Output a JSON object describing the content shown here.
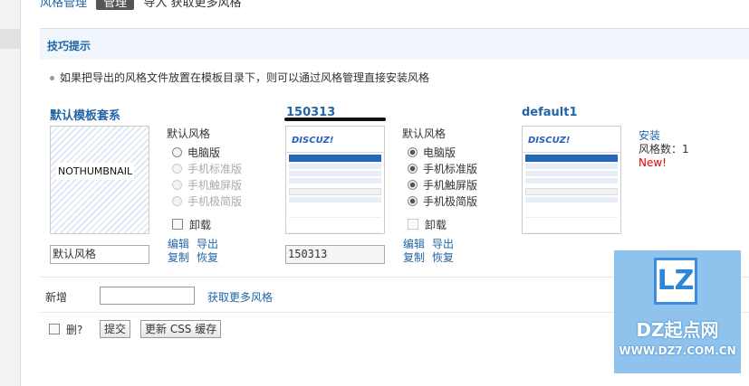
{
  "header": {
    "title": "风格管理",
    "tab_active": "管理",
    "tab_import": "导入",
    "tab_more": "获取更多风格"
  },
  "tips": {
    "heading": "技巧提示",
    "text": "如果把导出的风格文件放置在模板目录下，则可以通过风格管理直接安装风格"
  },
  "styles": [
    {
      "name": "默认模板套系",
      "thumb_text": "NOTHUMBNAIL",
      "default_label": "默认风格",
      "options": [
        "电脑版",
        "手机标准版",
        "手机触屏版",
        "手机极简版"
      ],
      "uninstall": "卸载",
      "input_value": "默认风格",
      "links": [
        "编辑",
        "导出",
        "复制",
        "恢复"
      ]
    },
    {
      "name": "150313",
      "default_label": "默认风格",
      "options": [
        "电脑版",
        "手机标准版",
        "手机触屏版",
        "手机极简版"
      ],
      "uninstall": "卸载",
      "input_value": "150313",
      "links": [
        "编辑",
        "导出",
        "复制",
        "恢复"
      ]
    },
    {
      "name": "default1",
      "install": "安装",
      "count": "风格数：1",
      "new": "New!"
    }
  ],
  "footer": {
    "add_label": "新增",
    "more_link": "获取更多风格",
    "delete_label": "删?",
    "submit": "提交",
    "update_css": "更新 CSS 缓存"
  },
  "watermark": {
    "logo": "LZ",
    "title": "DZ起点网",
    "url": "WWW.DZ7.COM.CN"
  },
  "thumb_logo": "DISCUZ!"
}
